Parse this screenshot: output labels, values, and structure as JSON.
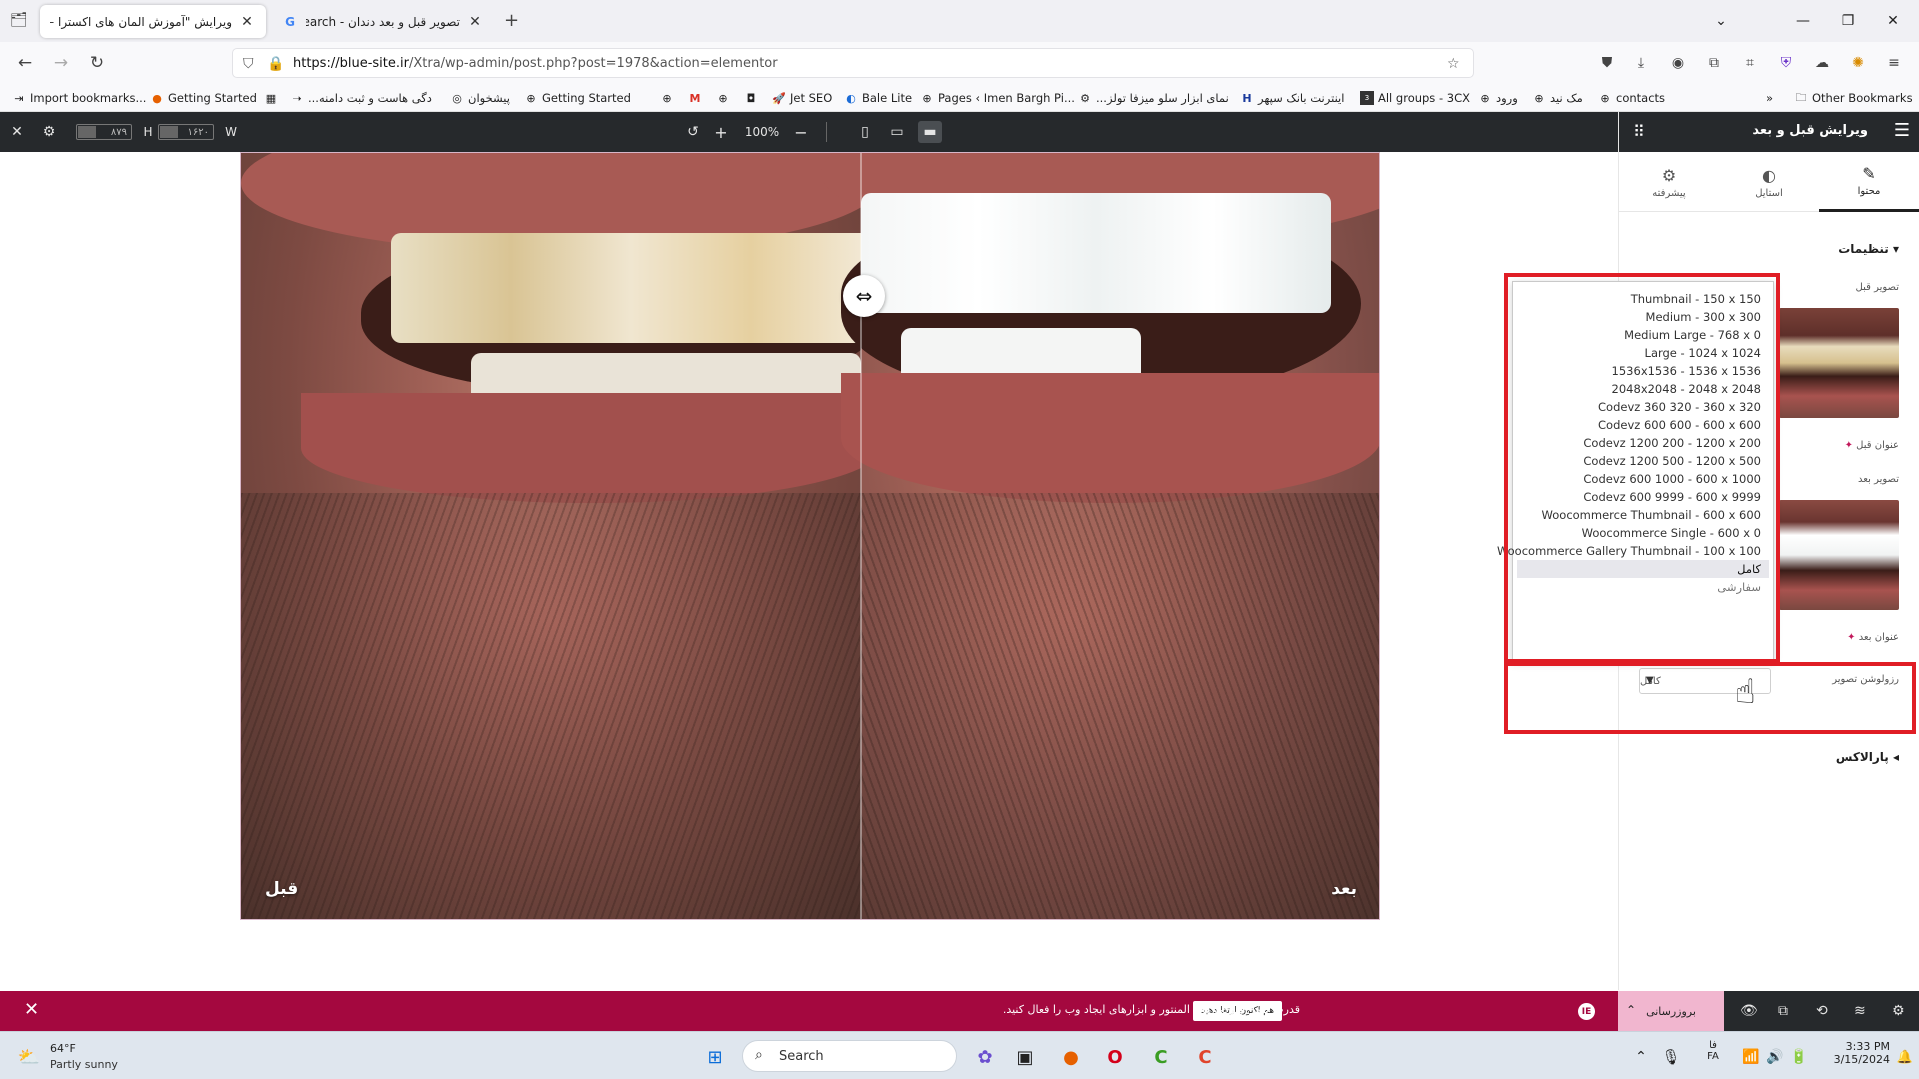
{
  "tabs": [
    {
      "title": "ویرایش \"آموزش المان های اکسترا – ...",
      "active": true
    },
    {
      "title": "تصویر قبل و بعد دندان - Search",
      "active": false
    }
  ],
  "url": {
    "host": "https://blue-site.ir",
    "path": "/Xtra/wp-admin/post.php?post=1978&action=elementor"
  },
  "bookmarks": [
    "Import bookmarks...",
    "Getting Started",
    "...دگی هاست و ثبت دامنه",
    "پیشخوان",
    "Getting Started",
    "Jet SEO",
    "Bale Lite",
    "Pages ‹ Imen Bargh Pi...",
    "...نمای ابزار سلو میزفا تولز",
    "اینترنت بانک سپهر",
    "All groups - 3CX",
    "ورود",
    "مک نید",
    "contacts"
  ],
  "other_bookmarks": "Other Bookmarks",
  "toolbar": {
    "width_label": "W",
    "width_value": "۱۶۲۰",
    "height_label": "H",
    "height_value": "۸۷۹",
    "zoom": "100%"
  },
  "photo": {
    "before_label": "قبل",
    "after_label": "بعد"
  },
  "panel": {
    "title": "ویرایش قبل و بعد",
    "tabs": [
      "محتوا",
      "استایل",
      "پیشرفته"
    ],
    "section_settings": "تنظیمات",
    "before_image_label": "تصویر قبل",
    "before_title_label": "عنوان قبل",
    "after_image_label": "تصویر بعد",
    "after_title_label": "عنوان بعد",
    "resolution_label": "رزولوشن تصویر",
    "resolution_value": "کامل",
    "section_parallax": "پارالاکس"
  },
  "dropdown": {
    "options": [
      "Thumbnail - 150 x 150",
      "Medium - 300 x 300",
      "Medium Large - 768 x 0",
      "Large - 1024 x 1024",
      "1536x1536 - 1536 x 1536",
      "2048x2048 - 2048 x 2048",
      "Codevz 360 320 - 360 x 320",
      "Codevz 600 600 - 600 x 600",
      "Codevz 1200 200 - 1200 x 200",
      "Codevz 1200 500 - 1200 x 500",
      "Codevz 600 1000 - 600 x 1000",
      "Codevz 600 9999 - 600 x 9999",
      "Woocommerce Thumbnail - 600 x 600",
      "Woocommerce Single - 600 x 0",
      "Woocommerce Gallery Thumbnail - 100 x 100",
      "کامل",
      "سفارشی"
    ],
    "selected": "کامل"
  },
  "notification": {
    "text": "قدرت کامل ویژگی های المنتور و ابزارهای ایجاد وب را فعال کنید.",
    "button": "هم اکنون ارتقا دهید",
    "badge": "IE"
  },
  "panel_footer": {
    "update_label": "بروزرسانی"
  },
  "taskbar": {
    "temperature": "64°F",
    "weather": "Partly sunny",
    "search_placeholder": "Search",
    "lang_top": "فا",
    "lang_bottom": "FA",
    "time": "3:33 PM",
    "date": "3/15/2024"
  },
  "colors": {
    "accent": "#a4083f",
    "dark": "#26292c",
    "highlight": "#e01d25"
  }
}
